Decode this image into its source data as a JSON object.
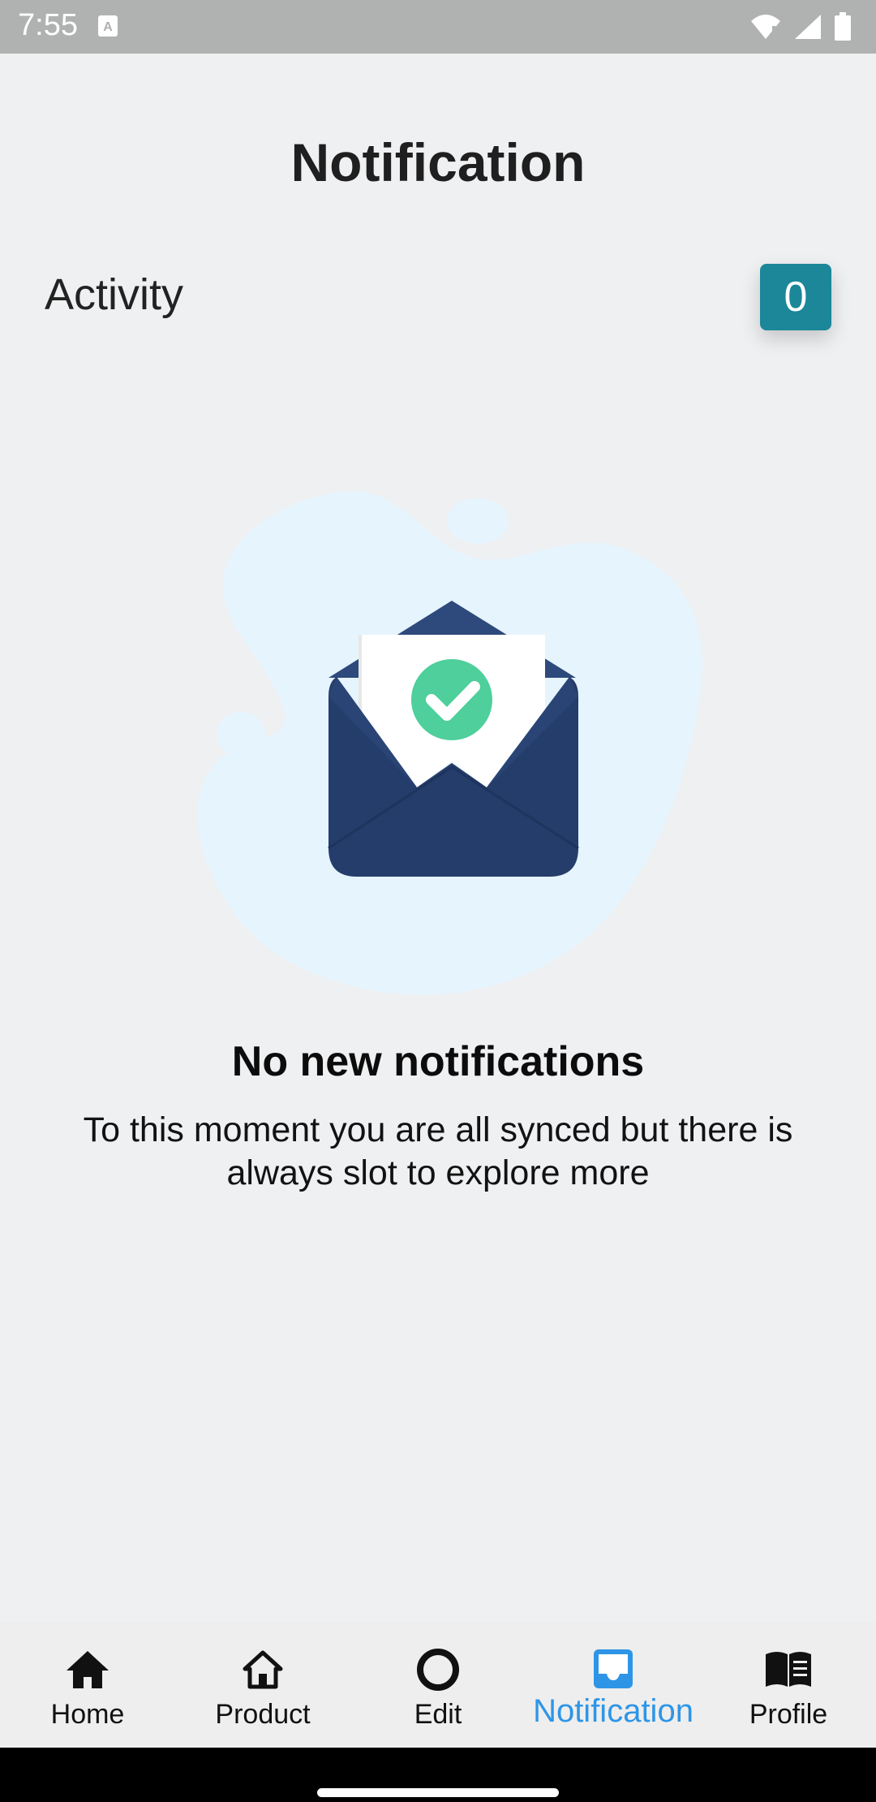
{
  "status_bar": {
    "time": "7:55",
    "icons": [
      "notification-a-icon",
      "wifi-icon",
      "signal-icon",
      "battery-icon"
    ]
  },
  "header": {
    "title": "Notification"
  },
  "activity": {
    "label": "Activity",
    "count": "0",
    "badge_color": "#1b8799"
  },
  "empty_state": {
    "illustration": "open-envelope-check-icon",
    "title": "No new notifications",
    "description": "To this moment you are all synced but there is always slot to explore more"
  },
  "bottom_nav": {
    "active_color": "#2e95e6",
    "items": [
      {
        "label": "Home",
        "icon": "home-filled-icon"
      },
      {
        "label": "Product",
        "icon": "home-outline-icon"
      },
      {
        "label": "Edit",
        "icon": "circle-icon"
      },
      {
        "label": "Notification",
        "icon": "inbox-icon",
        "active": true
      },
      {
        "label": "Profile",
        "icon": "book-icon"
      }
    ]
  }
}
